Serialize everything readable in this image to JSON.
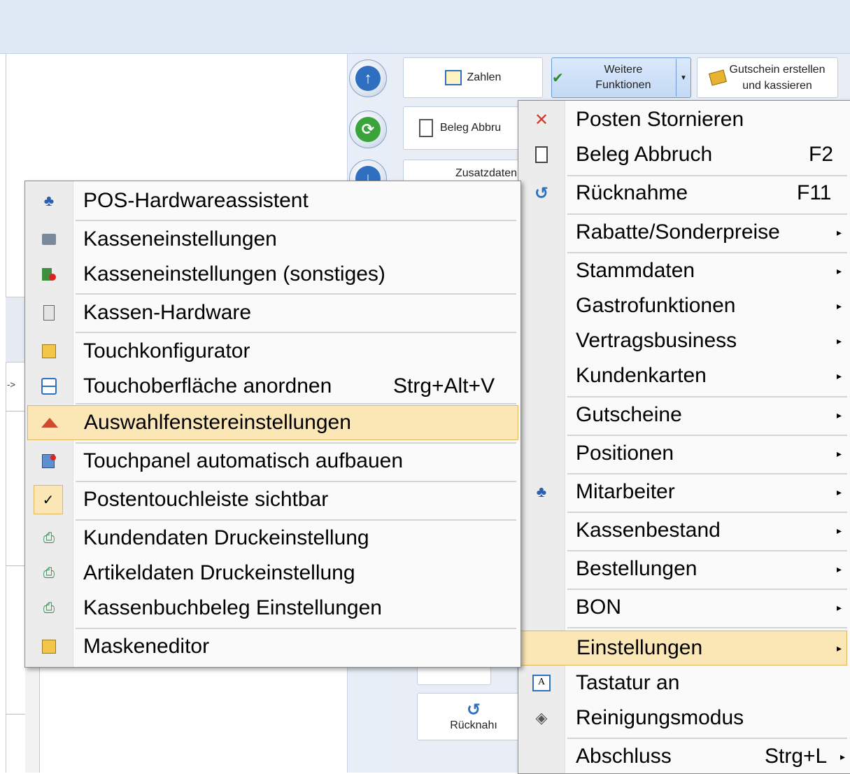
{
  "toolbar": {
    "zahlen": "Zahlen",
    "weitere_line1": "Weitere",
    "weitere_line2": "Funktionen",
    "gutschein_line1": "Gutschein erstellen",
    "gutschein_line2": "und kassieren",
    "beleg_abbruch": "Beleg Abbru",
    "zusatzdaten": "Zusatzdaten",
    "ruecknahme": "Rücknahı"
  },
  "left_panel": {
    "arrow_text": "->"
  },
  "main_menu": {
    "items": [
      {
        "label": "Posten Stornieren",
        "shortcut": "",
        "icon": "cross-icon"
      },
      {
        "label": "Beleg Abbruch",
        "shortcut": "F2",
        "icon": "document-icon"
      },
      {
        "label": "Rücknahme",
        "shortcut": "F11",
        "icon": "undo-icon"
      },
      {
        "label": "Rabatte/Sonderpreise",
        "shortcut": "",
        "icon": ""
      },
      {
        "label": "Stammdaten",
        "shortcut": "",
        "icon": ""
      },
      {
        "label": "Gastrofunktionen",
        "shortcut": "",
        "icon": ""
      },
      {
        "label": "Vertragsbusiness",
        "shortcut": "",
        "icon": ""
      },
      {
        "label": "Kundenkarten",
        "shortcut": "",
        "icon": ""
      },
      {
        "label": "Gutscheine",
        "shortcut": "",
        "icon": ""
      },
      {
        "label": "Positionen",
        "shortcut": "",
        "icon": ""
      },
      {
        "label": "Mitarbeiter",
        "shortcut": "",
        "icon": "users-icon"
      },
      {
        "label": "Kassenbestand",
        "shortcut": "",
        "icon": ""
      },
      {
        "label": "Bestellungen",
        "shortcut": "",
        "icon": ""
      },
      {
        "label": "BON",
        "shortcut": "",
        "icon": ""
      },
      {
        "label": "Einstellungen",
        "shortcut": "",
        "icon": ""
      },
      {
        "label": "Tastatur an",
        "shortcut": "",
        "icon": "keyboard-icon"
      },
      {
        "label": "Reinigungsmodus",
        "shortcut": "",
        "icon": "paint-bucket-icon"
      },
      {
        "label": "Abschluss",
        "shortcut": "Strg+L",
        "icon": ""
      }
    ]
  },
  "settings_menu": {
    "items": [
      {
        "label": "POS-Hardwareassistent",
        "shortcut": "",
        "icon": "users-icon"
      },
      {
        "label": "Kasseneinstellungen",
        "shortcut": "",
        "icon": "printer-icon"
      },
      {
        "label": "Kasseneinstellungen (sonstiges)",
        "shortcut": "",
        "icon": "register-alert-icon"
      },
      {
        "label": "Kassen-Hardware",
        "shortcut": "",
        "icon": "hardware-icon"
      },
      {
        "label": "Touchkonfigurator",
        "shortcut": "",
        "icon": "touch-config-icon"
      },
      {
        "label": "Touchoberfläche anordnen",
        "shortcut": "Strg+Alt+V",
        "icon": "arrange-icon"
      },
      {
        "label": "Auswahlfenstereinstellungen",
        "shortcut": "",
        "icon": "chart-window-icon"
      },
      {
        "label": "Touchpanel automatisch aufbauen",
        "shortcut": "",
        "icon": "panel-build-icon"
      },
      {
        "label": "Postentouchleiste sichtbar",
        "shortcut": "",
        "icon": "checkmark-icon"
      },
      {
        "label": "Kundendaten Druckeinstellung",
        "shortcut": "",
        "icon": "print-settings-icon"
      },
      {
        "label": "Artikeldaten Druckeinstellung",
        "shortcut": "",
        "icon": "print-settings-icon"
      },
      {
        "label": "Kassenbuchbeleg Einstellungen",
        "shortcut": "",
        "icon": "print-settings-icon"
      },
      {
        "label": "Maskeneditor",
        "shortcut": "",
        "icon": "touch-config-icon"
      }
    ]
  },
  "colors": {
    "highlight": "#fbe6b6",
    "highlight_border": "#e2b65d",
    "menu_bg": "#fafafa",
    "gutter": "#ececec",
    "title_bg": "#dfe8f5"
  }
}
